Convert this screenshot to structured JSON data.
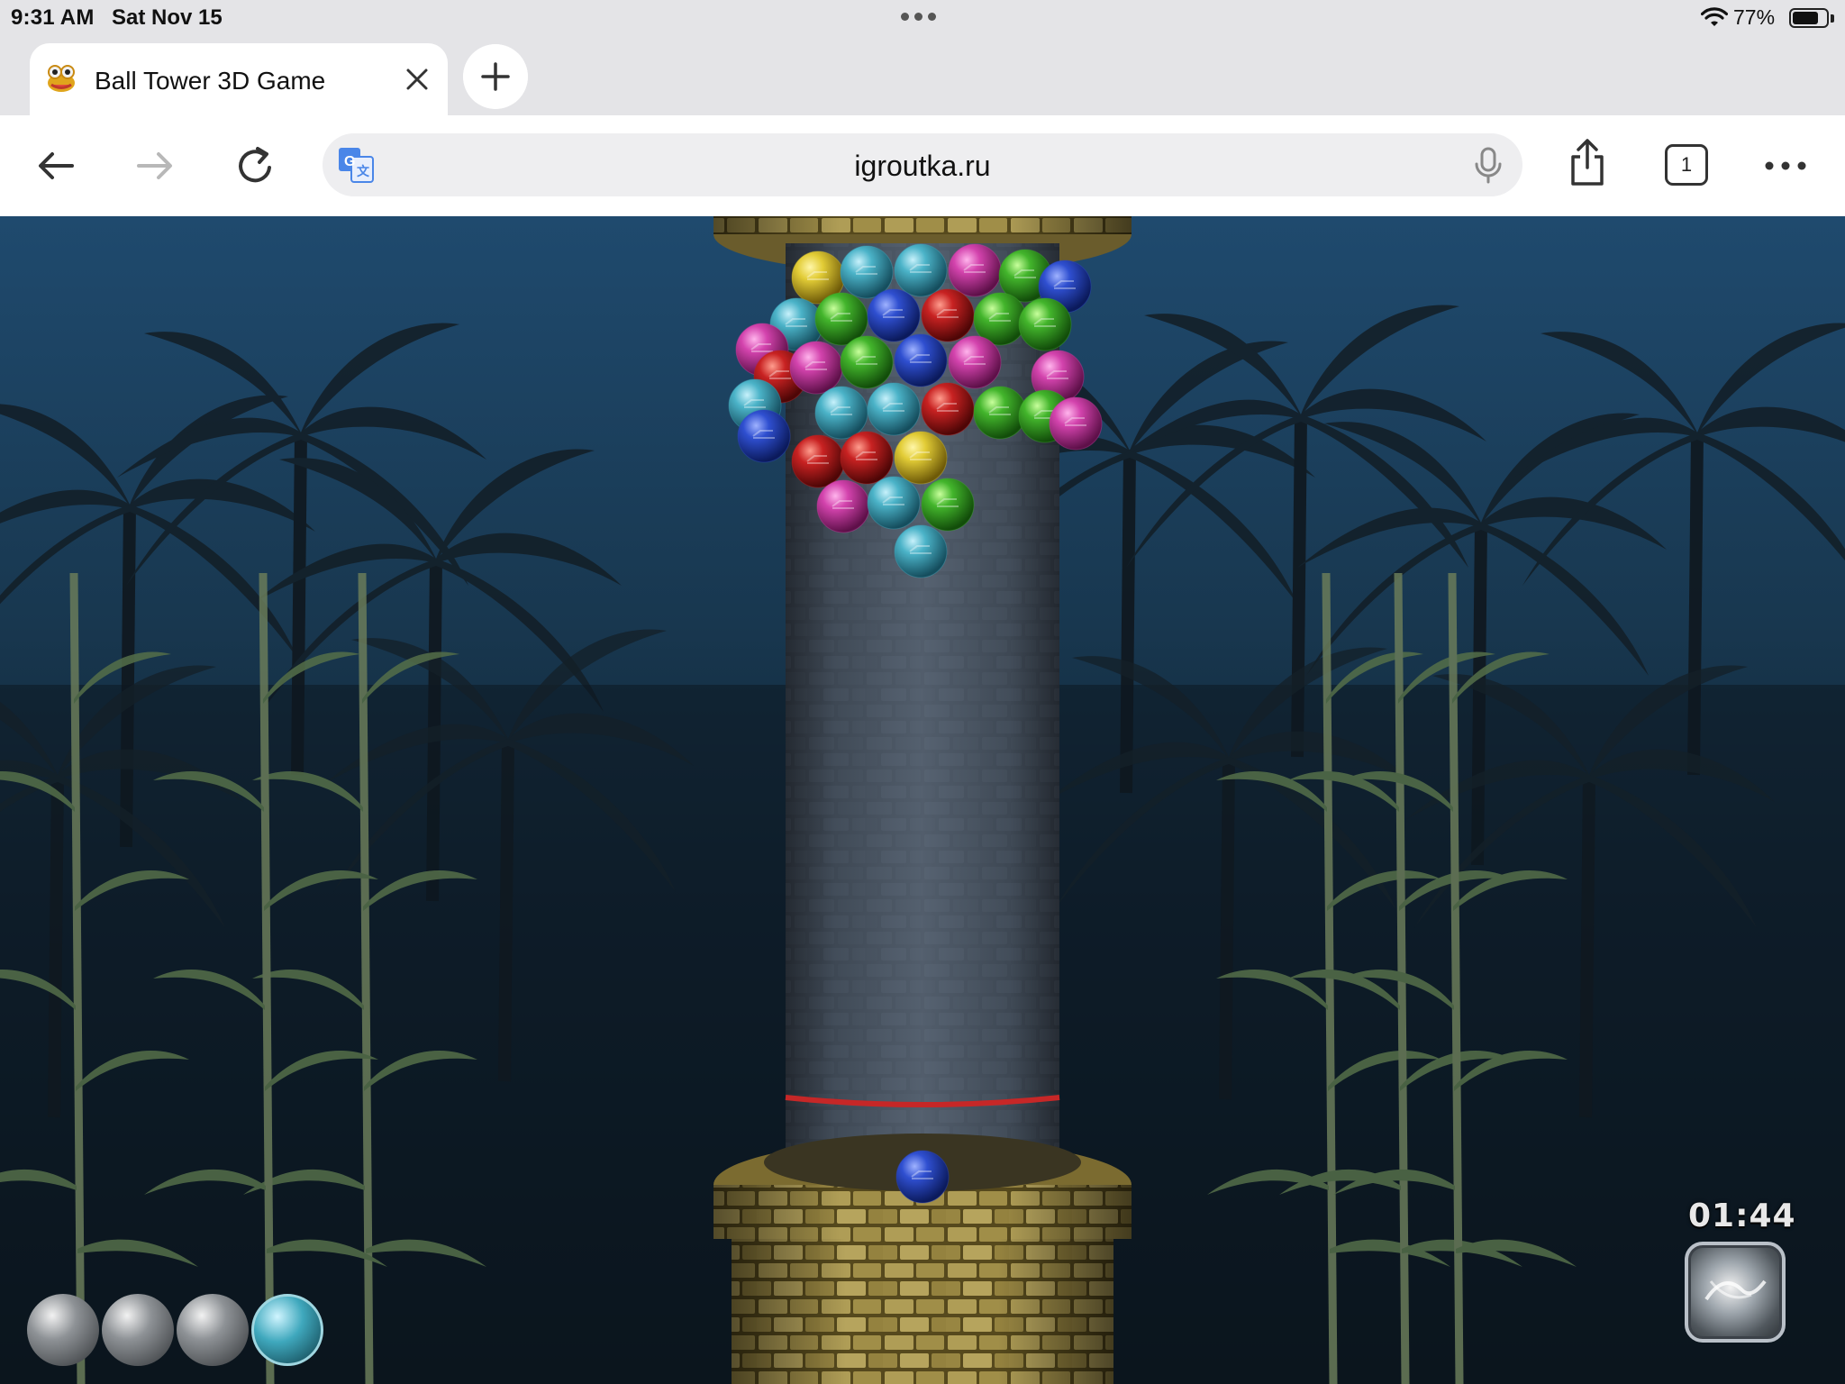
{
  "status_bar": {
    "time": "9:31 AM",
    "date": "Sat Nov 15",
    "battery_percent": "77%",
    "battery_level": 0.77,
    "icons": [
      "more-dots-icon",
      "wifi-icon",
      "battery-icon"
    ]
  },
  "tabs": [
    {
      "title": "Ball Tower 3D Game",
      "favicon": "frog-favicon-icon",
      "active": true
    }
  ],
  "toolbar": {
    "url": "igroutka.ru",
    "tab_count": "1",
    "icons": [
      "back-icon",
      "forward-icon",
      "reload-icon",
      "translate-icon",
      "mic-icon",
      "share-icon",
      "tabs-icon",
      "more-icon"
    ]
  },
  "game": {
    "timer": "01:44",
    "colors": {
      "yellow": "#d6c02c",
      "cyan": "#3fa8bd",
      "magenta": "#cc3fa6",
      "green": "#3eb02b",
      "blue": "#2c49c9",
      "red": "#c42020"
    },
    "next_balls": [
      {
        "kind": "empty"
      },
      {
        "kind": "empty"
      },
      {
        "kind": "empty"
      },
      {
        "kind": "cyan"
      }
    ],
    "shooter_ball": "blue",
    "powerup": "lightning-orb-icon"
  }
}
